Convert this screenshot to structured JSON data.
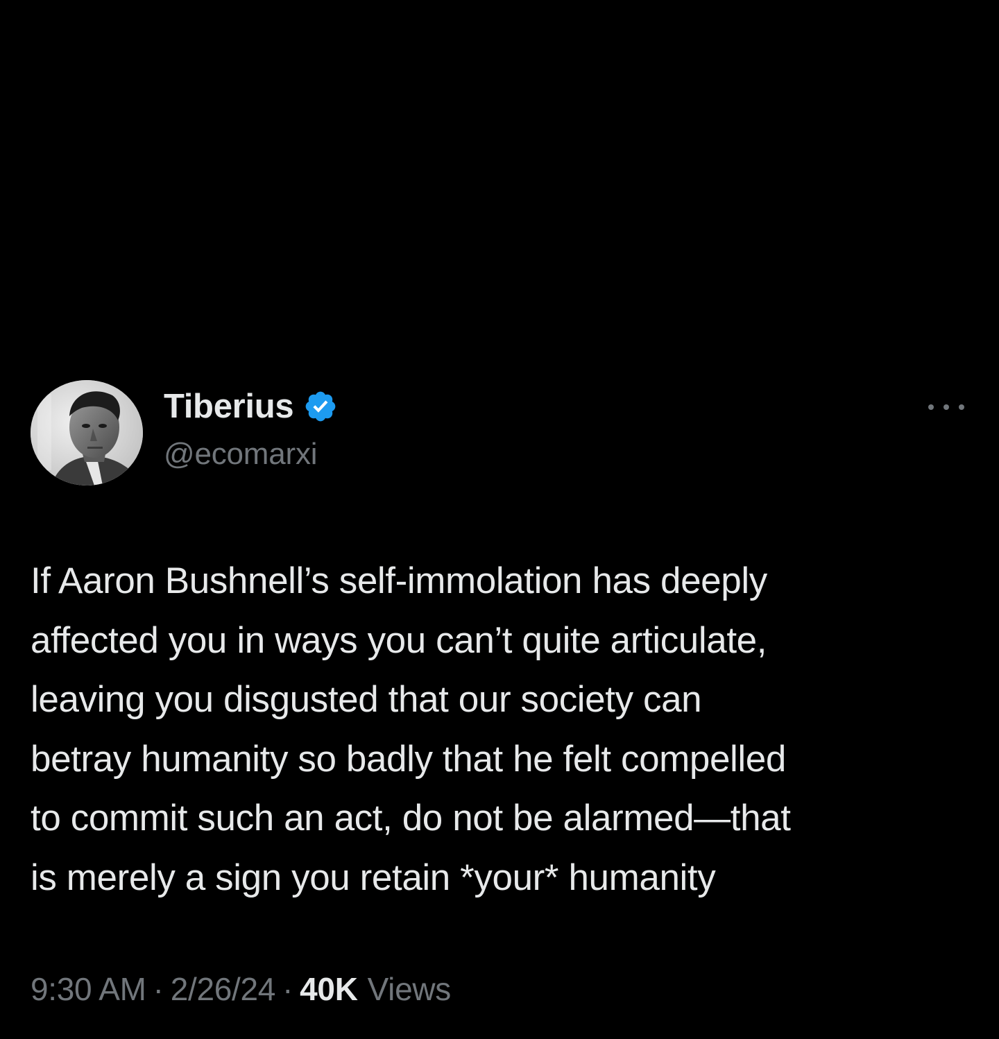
{
  "tweet": {
    "author": {
      "display_name": "Tiberius",
      "handle": "@ecomarxi",
      "verified": true
    },
    "text": "If Aaron Bushnell’s self-immolation has deeply\naffected you in ways you can’t quite articulate,\nleaving you disgusted that our society can\nbetray humanity so badly that he felt compelled\nto commit such an act, do not be alarmed—that\nis merely a sign you retain *your* humanity",
    "time": "9:30 AM",
    "date": "2/26/24",
    "separator": "·",
    "views_count": "40K",
    "views_label": "Views"
  },
  "icons": {
    "verified": "verified-badge-icon",
    "more": "more-options-icon"
  },
  "colors": {
    "background": "#000000",
    "primary_text": "#e7e9ea",
    "secondary_text": "#71767b",
    "verified_blue": "#1d9bf0"
  }
}
